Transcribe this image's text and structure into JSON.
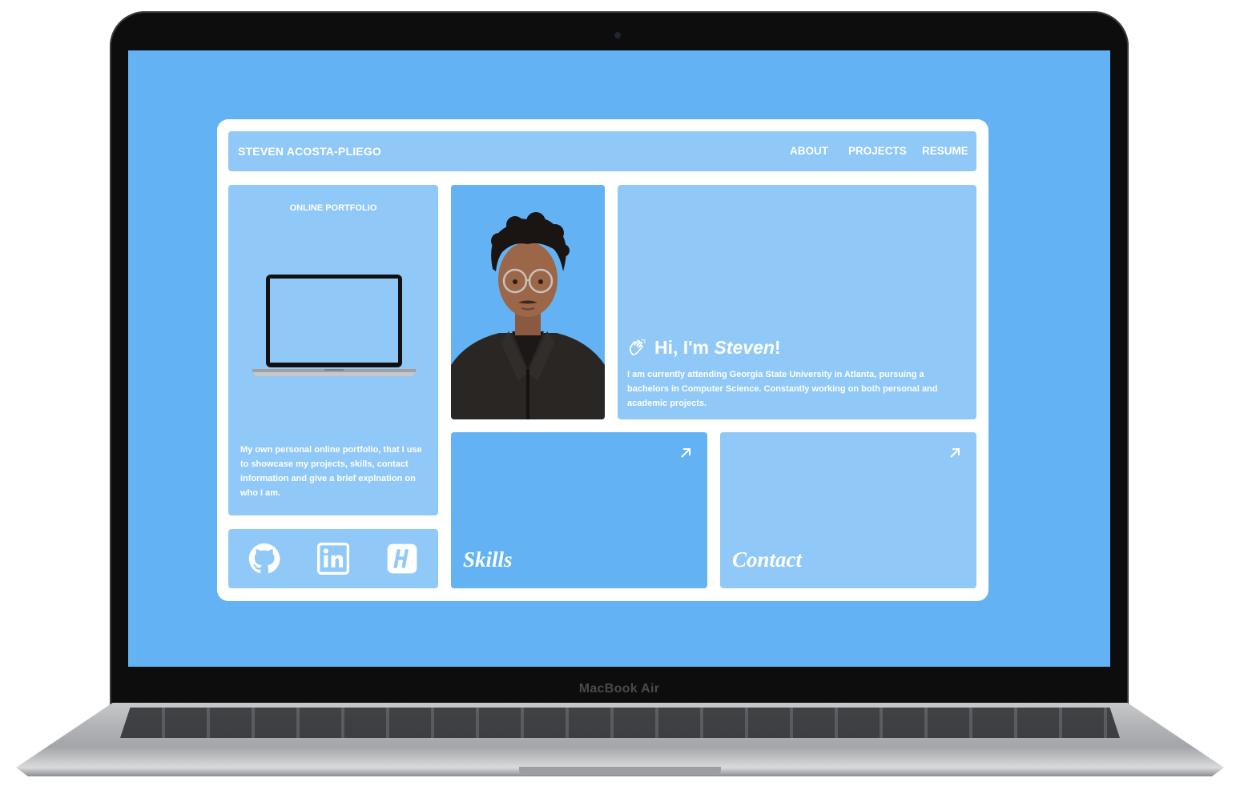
{
  "device": {
    "bezel_label": "MacBook Air"
  },
  "site": {
    "brand": "STEVEN ACOSTA-PLIEGO",
    "nav": {
      "about": "ABOUT",
      "projects": "PROJECTS",
      "resume": "RESUME"
    },
    "portfolio": {
      "title": "ONLINE PORTFOLIO",
      "description": "My own personal online portfolio, that I use to showcase my projects, skills, contact information and give a brief explnation on who I am."
    },
    "social": {
      "icons": [
        "github-icon",
        "linkedin-icon",
        "handshake-icon"
      ]
    },
    "intro": {
      "greeting_prefix": "Hi, I'm ",
      "greeting_name": "Steven",
      "greeting_suffix": "!",
      "icon": "clapping-hands-icon",
      "description": "I am currently attending Georgia State University in Atlanta, pursuing a bachelors in Computer Science. Constantly working on both personal and academic projects."
    },
    "tiles": {
      "skills": "Skills",
      "contact": "Contact",
      "icon": "arrow-up-right-icon"
    },
    "colors": {
      "background": "#63b3f4",
      "card_light": "#90c9f7",
      "card_dark": "#63b3f4",
      "frame": "#ffffff",
      "text": "#ffffff"
    }
  }
}
